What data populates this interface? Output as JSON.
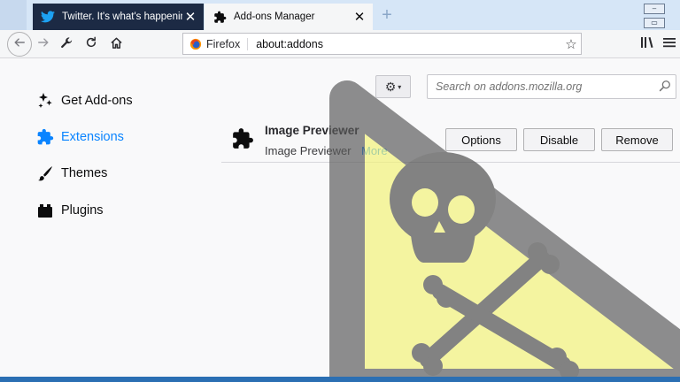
{
  "tabs": [
    {
      "title": "Twitter. It's what's happening.",
      "icon": "twitter-icon",
      "close": "✕"
    },
    {
      "title": "Add-ons Manager",
      "icon": "puzzle-icon",
      "close": "✕"
    }
  ],
  "newtab": "+",
  "urlbar": {
    "identity": "Firefox",
    "url": "about:addons"
  },
  "sidebar": {
    "items": [
      {
        "label": "Get Add-ons",
        "icon": "get-addons-icon",
        "selected": false
      },
      {
        "label": "Extensions",
        "icon": "puzzle-icon",
        "selected": true
      },
      {
        "label": "Themes",
        "icon": "brush-icon",
        "selected": false
      },
      {
        "label": "Plugins",
        "icon": "plugin-icon",
        "selected": false
      }
    ]
  },
  "search": {
    "placeholder": "Search on addons.mozilla.org"
  },
  "addon": {
    "name": "Image Previewer",
    "description": "Image Previewer",
    "more": "More",
    "buttons": {
      "options": "Options",
      "disable": "Disable",
      "remove": "Remove"
    }
  },
  "colors": {
    "accent": "#0a84ff",
    "warning_fill": "#f2f276",
    "warning_border": "#5a5a5a"
  }
}
